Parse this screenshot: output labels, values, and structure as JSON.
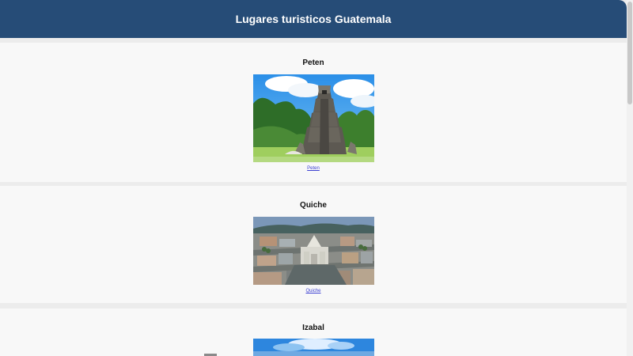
{
  "header": {
    "title": "Lugares turisticos Guatemala"
  },
  "places": [
    {
      "title": "Peten",
      "link_label": "Peten",
      "image_name": "tikal-temple-image"
    },
    {
      "title": "Quiche",
      "link_label": "Quiche",
      "image_name": "quiche-aerial-image"
    },
    {
      "title": "Izabal",
      "image_name": "izabal-sky-image"
    }
  ],
  "colors": {
    "header": "#264c77",
    "page_background": "#ececec",
    "card_background": "#f8f8f8",
    "link": "#3e42d2"
  }
}
